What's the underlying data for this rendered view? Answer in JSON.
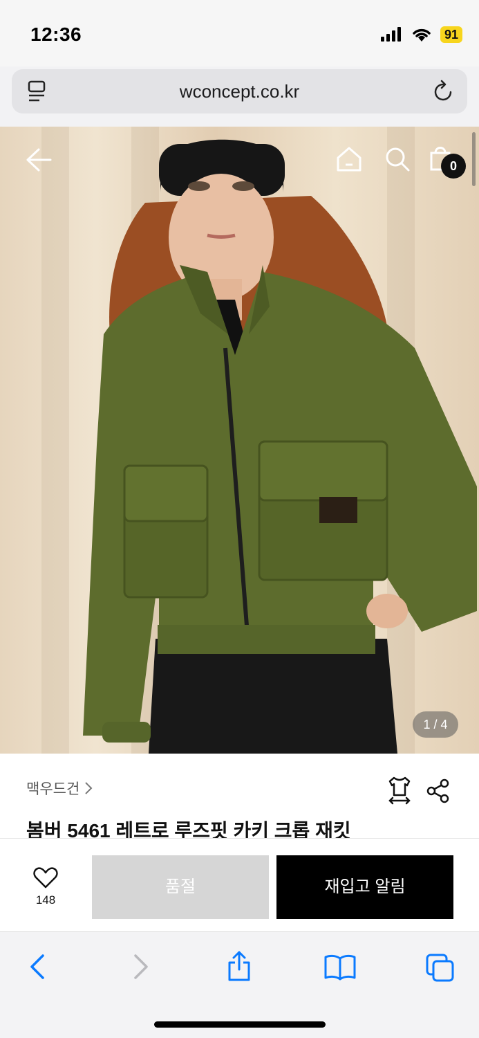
{
  "status_bar": {
    "time": "12:36",
    "battery": "91"
  },
  "browser": {
    "url": "wconcept.co.kr"
  },
  "hero": {
    "image_counter": "1 / 4",
    "cart_count": "0"
  },
  "product": {
    "brand": "맥우드건",
    "title": "봄버 5461 레트로 루즈핏 카키 크롭 재킷"
  },
  "actions": {
    "like_count": "148",
    "soldout_label": "품절",
    "restock_label": "재입고 알림"
  },
  "colors": {
    "accent_ios_blue": "#0a7aff",
    "jacket": "#5b6b2a",
    "soldout_bg": "#d6d6d6",
    "primary_button": "#000000"
  },
  "icons": [
    "signal-icon",
    "wifi-icon",
    "reader-icon",
    "reload-icon",
    "back-arrow-icon",
    "home-icon",
    "search-icon",
    "cart-icon",
    "size-guide-icon",
    "share-icon",
    "heart-icon",
    "browser-back-icon",
    "browser-forward-icon",
    "share-sheet-icon",
    "bookmarks-icon",
    "tabs-icon"
  ]
}
